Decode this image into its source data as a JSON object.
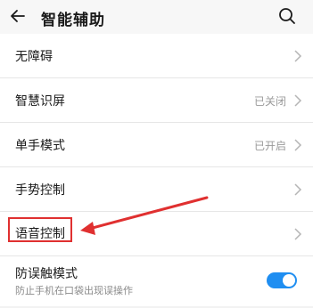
{
  "header": {
    "title": "智能辅助",
    "back_icon": "arrow-left-icon",
    "search_icon": "search-icon"
  },
  "items": [
    {
      "label": "无障碍",
      "status": ""
    },
    {
      "label": "智慧识屏",
      "status": "已关闭"
    },
    {
      "label": "单手模式",
      "status": "已开启"
    },
    {
      "label": "手势控制",
      "status": ""
    },
    {
      "label": "语音控制",
      "status": ""
    }
  ],
  "toggle_item": {
    "label": "防误触模式",
    "sublabel": "防止手机在口袋出现误操作",
    "enabled": true
  },
  "colors": {
    "accent": "#1f8ef1",
    "annotation": "#e03030"
  }
}
